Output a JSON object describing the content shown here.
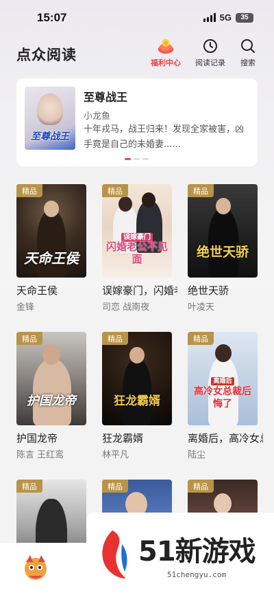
{
  "status_bar": {
    "time": "15:07",
    "network": "5G",
    "battery": "35"
  },
  "header": {
    "app_title": "点众阅读",
    "welfare_label": "福利中心",
    "history_label": "阅读记录",
    "search_label": "搜索"
  },
  "banner": {
    "title": "至尊战王",
    "cover_title": "至尊战王",
    "author": "小龙鱼",
    "description": "十年戎马，战王归来！发现全家被害，凶手竟是自己的未婚妻......",
    "active_page": 1,
    "page_count": 3
  },
  "books": [
    {
      "badge": "精品",
      "title": "天命王侯",
      "author": "金锋",
      "cover_text": "天命王侯"
    },
    {
      "badge": "精品",
      "title": "误嫁豪门，闪婚老公不见面",
      "author": "司恋  战南夜",
      "cover_text": "闪婚老公不见面",
      "cover_subtext": "误嫁豪门"
    },
    {
      "badge": "精品",
      "title": "绝世天骄",
      "author": "叶凌天",
      "cover_text": "绝世天骄"
    },
    {
      "badge": "精品",
      "title": "护国龙帝",
      "author": "陈言  王红鸾",
      "cover_text": "护国龙帝"
    },
    {
      "badge": "精品",
      "title": "狂龙霸婿",
      "author": "林平凡",
      "cover_text": "狂龙霸婿"
    },
    {
      "badge": "精品",
      "title": "离婚后，高冷女总裁后悔了",
      "author": "陆尘",
      "cover_text": "高冷女总裁后悔了",
      "cover_subtext": "离婚后"
    },
    {
      "badge": "精品"
    },
    {
      "badge": "精品"
    },
    {
      "badge": "精品"
    }
  ],
  "watermark": {
    "brand": "51新游戏",
    "url": "51chengyu.com"
  },
  "colors": {
    "accent": "#e84545",
    "badge": "#b8934a"
  }
}
